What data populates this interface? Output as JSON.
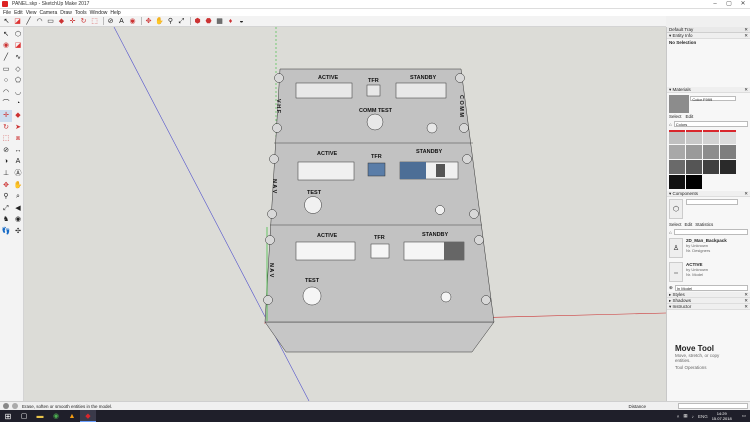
{
  "window": {
    "title": "PANEL.skp - SketchUp Make 2017"
  },
  "menu": [
    "File",
    "Edit",
    "View",
    "Camera",
    "Draw",
    "Tools",
    "Window",
    "Help"
  ],
  "panel_labels": {
    "vhf_active": "ACTIVE",
    "vhf_tfr": "TFR",
    "vhf_standby": "STANDBY",
    "comm_test": "COMM TEST",
    "vhf_side": "V H F",
    "comm_side": "C O M M",
    "nav1_active": "ACTIVE",
    "nav1_tfr": "TFR",
    "nav1_standby": "STANDBY",
    "nav1_test": "TEST",
    "nav1_side": "N A V",
    "nav2_active": "ACTIVE",
    "nav2_tfr": "TFR",
    "nav2_standby": "STANDBY",
    "nav2_test": "TEST",
    "nav2_side": "N A V"
  },
  "tray": {
    "title": "Default Tray",
    "entity_info": {
      "label": "Entity Info",
      "value": "No Selection"
    },
    "materials": {
      "label": "Materials",
      "current": "Color F999",
      "mode_label": "Select",
      "edit_label": "Edit",
      "library": "Colors"
    },
    "components": {
      "label": "Components",
      "mode_label": "Select",
      "edit_label": "Edit",
      "stats_label": "Statistics",
      "items": [
        {
          "name": "2D_Man_Backpack",
          "by": "by Unknown",
          "sub": "Nr. Designers"
        },
        {
          "name": "ACTIVE",
          "by": "by Unknown",
          "sub": "Nr. Model"
        }
      ],
      "filter": "In Model"
    },
    "collapsed": [
      "Styles",
      "Shadows",
      "Instructor"
    ],
    "instructor": {
      "title": "Move Tool",
      "desc": "Move, stretch, or copy entities.",
      "footer": "Tool Operations"
    }
  },
  "status": {
    "message": "Erase, soften or smooth entities in the model.",
    "measure_label": "Distance"
  },
  "taskbar": {
    "lang": "ENG",
    "time": "14:29",
    "date": "15.07.2018"
  },
  "colors": {
    "accent": "#d9262c",
    "panel_face": "#c4c4c4",
    "bg": "#dcdcd7"
  }
}
